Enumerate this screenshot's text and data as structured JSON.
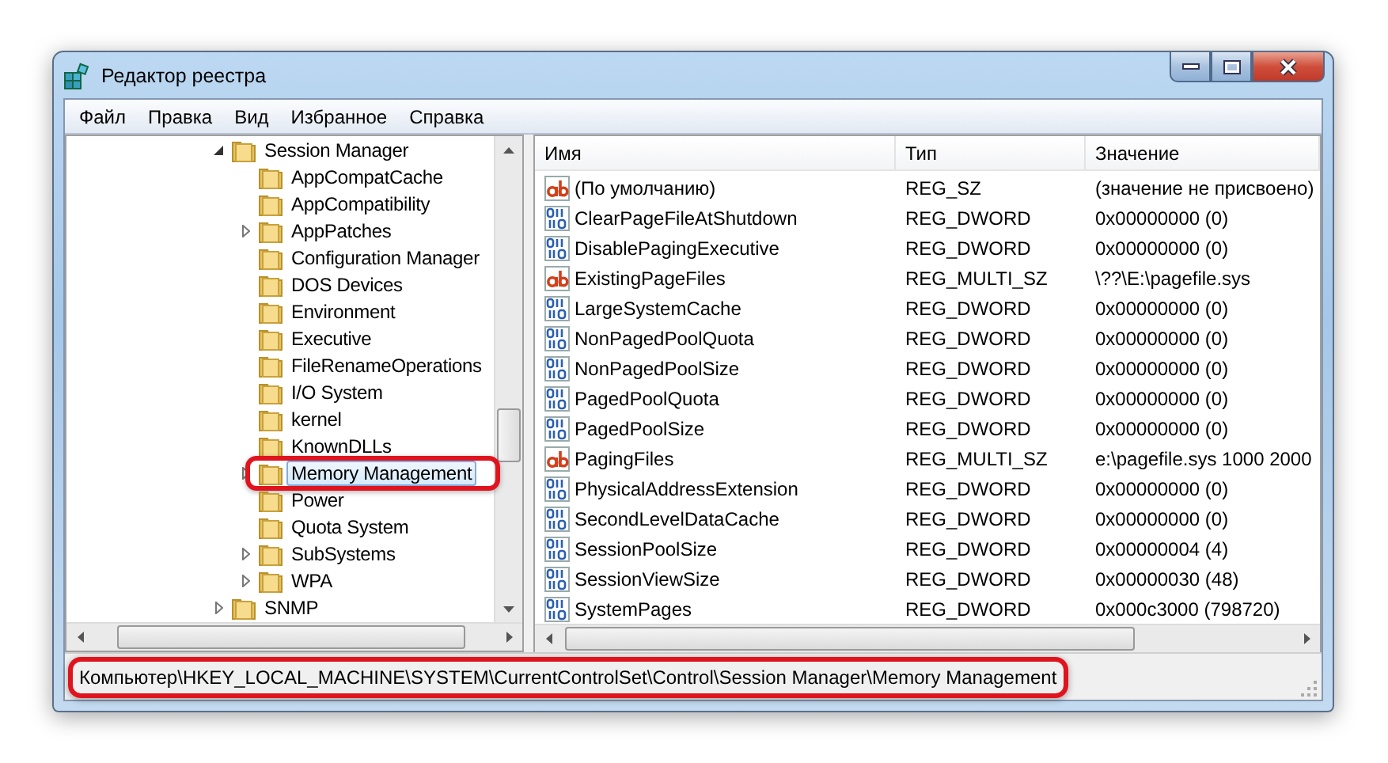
{
  "window": {
    "title": "Редактор реестра"
  },
  "menu": [
    "Файл",
    "Правка",
    "Вид",
    "Избранное",
    "Справка"
  ],
  "tree": [
    {
      "label": "Session Manager",
      "expandable": true,
      "expanded": true,
      "selected": false,
      "callout": false,
      "children": [
        {
          "label": "AppCompatCache",
          "expandable": false,
          "selected": false,
          "callout": false
        },
        {
          "label": "AppCompatibility",
          "expandable": false,
          "selected": false,
          "callout": false
        },
        {
          "label": "AppPatches",
          "expandable": true,
          "selected": false,
          "callout": false
        },
        {
          "label": "Configuration Manager",
          "expandable": false,
          "selected": false,
          "callout": false
        },
        {
          "label": "DOS Devices",
          "expandable": false,
          "selected": false,
          "callout": false
        },
        {
          "label": "Environment",
          "expandable": false,
          "selected": false,
          "callout": false
        },
        {
          "label": "Executive",
          "expandable": false,
          "selected": false,
          "callout": false
        },
        {
          "label": "FileRenameOperations",
          "expandable": false,
          "selected": false,
          "callout": false
        },
        {
          "label": "I/O System",
          "expandable": false,
          "selected": false,
          "callout": false
        },
        {
          "label": "kernel",
          "expandable": false,
          "selected": false,
          "callout": false
        },
        {
          "label": "KnownDLLs",
          "expandable": false,
          "selected": false,
          "callout": false
        },
        {
          "label": "Memory Management",
          "expandable": true,
          "selected": true,
          "callout": true
        },
        {
          "label": "Power",
          "expandable": false,
          "selected": false,
          "callout": false
        },
        {
          "label": "Quota System",
          "expandable": false,
          "selected": false,
          "callout": false
        },
        {
          "label": "SubSystems",
          "expandable": true,
          "selected": false,
          "callout": false
        },
        {
          "label": "WPA",
          "expandable": true,
          "selected": false,
          "callout": false
        }
      ]
    },
    {
      "label": "SNMP",
      "expandable": true,
      "expanded": false,
      "selected": false,
      "callout": false
    }
  ],
  "columns": [
    "Имя",
    "Тип",
    "Значение"
  ],
  "rows": [
    {
      "kind": "string",
      "name": "(По умолчанию)",
      "type": "REG_SZ",
      "value": "(значение не присвоено)"
    },
    {
      "kind": "binary",
      "name": "ClearPageFileAtShutdown",
      "type": "REG_DWORD",
      "value": "0x00000000 (0)"
    },
    {
      "kind": "binary",
      "name": "DisablePagingExecutive",
      "type": "REG_DWORD",
      "value": "0x00000000 (0)"
    },
    {
      "kind": "string",
      "name": "ExistingPageFiles",
      "type": "REG_MULTI_SZ",
      "value": "\\??\\E:\\pagefile.sys"
    },
    {
      "kind": "binary",
      "name": "LargeSystemCache",
      "type": "REG_DWORD",
      "value": "0x00000000 (0)"
    },
    {
      "kind": "binary",
      "name": "NonPagedPoolQuota",
      "type": "REG_DWORD",
      "value": "0x00000000 (0)"
    },
    {
      "kind": "binary",
      "name": "NonPagedPoolSize",
      "type": "REG_DWORD",
      "value": "0x00000000 (0)"
    },
    {
      "kind": "binary",
      "name": "PagedPoolQuota",
      "type": "REG_DWORD",
      "value": "0x00000000 (0)"
    },
    {
      "kind": "binary",
      "name": "PagedPoolSize",
      "type": "REG_DWORD",
      "value": "0x00000000 (0)"
    },
    {
      "kind": "string",
      "name": "PagingFiles",
      "type": "REG_MULTI_SZ",
      "value": "e:\\pagefile.sys 1000 2000"
    },
    {
      "kind": "binary",
      "name": "PhysicalAddressExtension",
      "type": "REG_DWORD",
      "value": "0x00000000 (0)"
    },
    {
      "kind": "binary",
      "name": "SecondLevelDataCache",
      "type": "REG_DWORD",
      "value": "0x00000000 (0)"
    },
    {
      "kind": "binary",
      "name": "SessionPoolSize",
      "type": "REG_DWORD",
      "value": "0x00000004 (4)"
    },
    {
      "kind": "binary",
      "name": "SessionViewSize",
      "type": "REG_DWORD",
      "value": "0x00000030 (48)"
    },
    {
      "kind": "binary",
      "name": "SystemPages",
      "type": "REG_DWORD",
      "value": "0x000c3000 (798720)"
    }
  ],
  "status_bar": {
    "path": "Компьютер\\HKEY_LOCAL_MACHINE\\SYSTEM\\CurrentControlSet\\Control\\Session Manager\\Memory Management",
    "callout": true
  }
}
